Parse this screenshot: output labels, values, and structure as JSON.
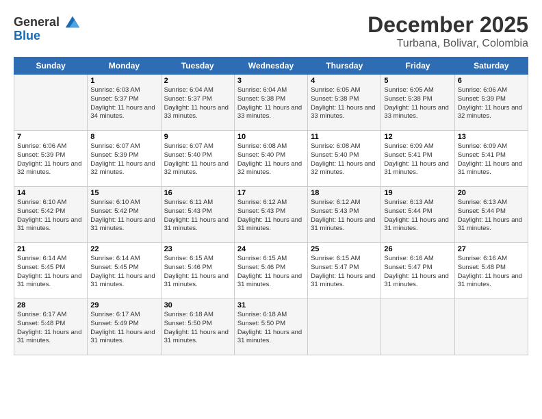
{
  "header": {
    "logo_line1": "General",
    "logo_line2": "Blue",
    "month": "December 2025",
    "location": "Turbana, Bolivar, Colombia"
  },
  "weekdays": [
    "Sunday",
    "Monday",
    "Tuesday",
    "Wednesday",
    "Thursday",
    "Friday",
    "Saturday"
  ],
  "weeks": [
    [
      {
        "day": "",
        "sunrise": "",
        "sunset": "",
        "daylight": ""
      },
      {
        "day": "1",
        "sunrise": "6:03 AM",
        "sunset": "5:37 PM",
        "daylight": "11 hours and 34 minutes."
      },
      {
        "day": "2",
        "sunrise": "6:04 AM",
        "sunset": "5:37 PM",
        "daylight": "11 hours and 33 minutes."
      },
      {
        "day": "3",
        "sunrise": "6:04 AM",
        "sunset": "5:38 PM",
        "daylight": "11 hours and 33 minutes."
      },
      {
        "day": "4",
        "sunrise": "6:05 AM",
        "sunset": "5:38 PM",
        "daylight": "11 hours and 33 minutes."
      },
      {
        "day": "5",
        "sunrise": "6:05 AM",
        "sunset": "5:38 PM",
        "daylight": "11 hours and 33 minutes."
      },
      {
        "day": "6",
        "sunrise": "6:06 AM",
        "sunset": "5:39 PM",
        "daylight": "11 hours and 32 minutes."
      }
    ],
    [
      {
        "day": "7",
        "sunrise": "6:06 AM",
        "sunset": "5:39 PM",
        "daylight": "11 hours and 32 minutes."
      },
      {
        "day": "8",
        "sunrise": "6:07 AM",
        "sunset": "5:39 PM",
        "daylight": "11 hours and 32 minutes."
      },
      {
        "day": "9",
        "sunrise": "6:07 AM",
        "sunset": "5:40 PM",
        "daylight": "11 hours and 32 minutes."
      },
      {
        "day": "10",
        "sunrise": "6:08 AM",
        "sunset": "5:40 PM",
        "daylight": "11 hours and 32 minutes."
      },
      {
        "day": "11",
        "sunrise": "6:08 AM",
        "sunset": "5:40 PM",
        "daylight": "11 hours and 32 minutes."
      },
      {
        "day": "12",
        "sunrise": "6:09 AM",
        "sunset": "5:41 PM",
        "daylight": "11 hours and 31 minutes."
      },
      {
        "day": "13",
        "sunrise": "6:09 AM",
        "sunset": "5:41 PM",
        "daylight": "11 hours and 31 minutes."
      }
    ],
    [
      {
        "day": "14",
        "sunrise": "6:10 AM",
        "sunset": "5:42 PM",
        "daylight": "11 hours and 31 minutes."
      },
      {
        "day": "15",
        "sunrise": "6:10 AM",
        "sunset": "5:42 PM",
        "daylight": "11 hours and 31 minutes."
      },
      {
        "day": "16",
        "sunrise": "6:11 AM",
        "sunset": "5:43 PM",
        "daylight": "11 hours and 31 minutes."
      },
      {
        "day": "17",
        "sunrise": "6:12 AM",
        "sunset": "5:43 PM",
        "daylight": "11 hours and 31 minutes."
      },
      {
        "day": "18",
        "sunrise": "6:12 AM",
        "sunset": "5:43 PM",
        "daylight": "11 hours and 31 minutes."
      },
      {
        "day": "19",
        "sunrise": "6:13 AM",
        "sunset": "5:44 PM",
        "daylight": "11 hours and 31 minutes."
      },
      {
        "day": "20",
        "sunrise": "6:13 AM",
        "sunset": "5:44 PM",
        "daylight": "11 hours and 31 minutes."
      }
    ],
    [
      {
        "day": "21",
        "sunrise": "6:14 AM",
        "sunset": "5:45 PM",
        "daylight": "11 hours and 31 minutes."
      },
      {
        "day": "22",
        "sunrise": "6:14 AM",
        "sunset": "5:45 PM",
        "daylight": "11 hours and 31 minutes."
      },
      {
        "day": "23",
        "sunrise": "6:15 AM",
        "sunset": "5:46 PM",
        "daylight": "11 hours and 31 minutes."
      },
      {
        "day": "24",
        "sunrise": "6:15 AM",
        "sunset": "5:46 PM",
        "daylight": "11 hours and 31 minutes."
      },
      {
        "day": "25",
        "sunrise": "6:15 AM",
        "sunset": "5:47 PM",
        "daylight": "11 hours and 31 minutes."
      },
      {
        "day": "26",
        "sunrise": "6:16 AM",
        "sunset": "5:47 PM",
        "daylight": "11 hours and 31 minutes."
      },
      {
        "day": "27",
        "sunrise": "6:16 AM",
        "sunset": "5:48 PM",
        "daylight": "11 hours and 31 minutes."
      }
    ],
    [
      {
        "day": "28",
        "sunrise": "6:17 AM",
        "sunset": "5:48 PM",
        "daylight": "11 hours and 31 minutes."
      },
      {
        "day": "29",
        "sunrise": "6:17 AM",
        "sunset": "5:49 PM",
        "daylight": "11 hours and 31 minutes."
      },
      {
        "day": "30",
        "sunrise": "6:18 AM",
        "sunset": "5:50 PM",
        "daylight": "11 hours and 31 minutes."
      },
      {
        "day": "31",
        "sunrise": "6:18 AM",
        "sunset": "5:50 PM",
        "daylight": "11 hours and 31 minutes."
      },
      {
        "day": "",
        "sunrise": "",
        "sunset": "",
        "daylight": ""
      },
      {
        "day": "",
        "sunrise": "",
        "sunset": "",
        "daylight": ""
      },
      {
        "day": "",
        "sunrise": "",
        "sunset": "",
        "daylight": ""
      }
    ]
  ]
}
